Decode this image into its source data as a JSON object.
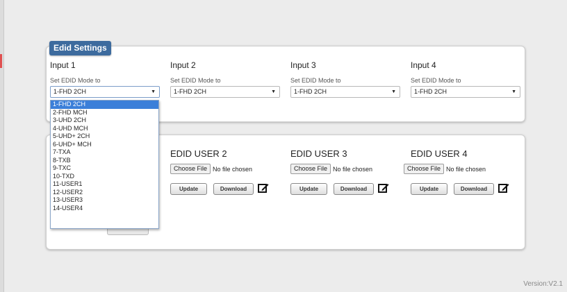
{
  "edid_settings": {
    "tab_label": "Edid Settings",
    "inputs": [
      {
        "title": "Input 1",
        "mode_label": "Set EDID Mode to",
        "selected": "1-FHD 2CH"
      },
      {
        "title": "Input 2",
        "mode_label": "Set EDID Mode to",
        "selected": "1-FHD 2CH"
      },
      {
        "title": "Input 3",
        "mode_label": "Set EDID Mode to",
        "selected": "1-FHD 2CH"
      },
      {
        "title": "Input 4",
        "mode_label": "Set EDID Mode to",
        "selected": "1-FHD 2CH"
      }
    ],
    "dropdown_options": [
      "1-FHD 2CH",
      "2-FHD MCH",
      "3-UHD 2CH",
      "4-UHD MCH",
      "5-UHD+ 2CH",
      "6-UHD+ MCH",
      "7-TXA",
      "8-TXB",
      "9-TXC",
      "10-TXD",
      "11-USER1",
      "12-USER2",
      "13-USER3",
      "14-USER4"
    ]
  },
  "edid_users": [
    {
      "title": "EDID USER 2",
      "choose_label": "Choose File",
      "no_file": "No file chosen",
      "update_label": "Update",
      "download_label": "Download"
    },
    {
      "title": "EDID USER 3",
      "choose_label": "Choose File",
      "no_file": "No file chosen",
      "update_label": "Update",
      "download_label": "Download"
    },
    {
      "title": "EDID USER 4",
      "choose_label": "Choose File",
      "no_file": "No file chosen",
      "update_label": "Update",
      "download_label": "Download"
    }
  ],
  "footer": {
    "version": "Version:V2.1"
  },
  "colors": {
    "tab": "#3d6b9e",
    "selected_option": "#3b7fd9"
  }
}
